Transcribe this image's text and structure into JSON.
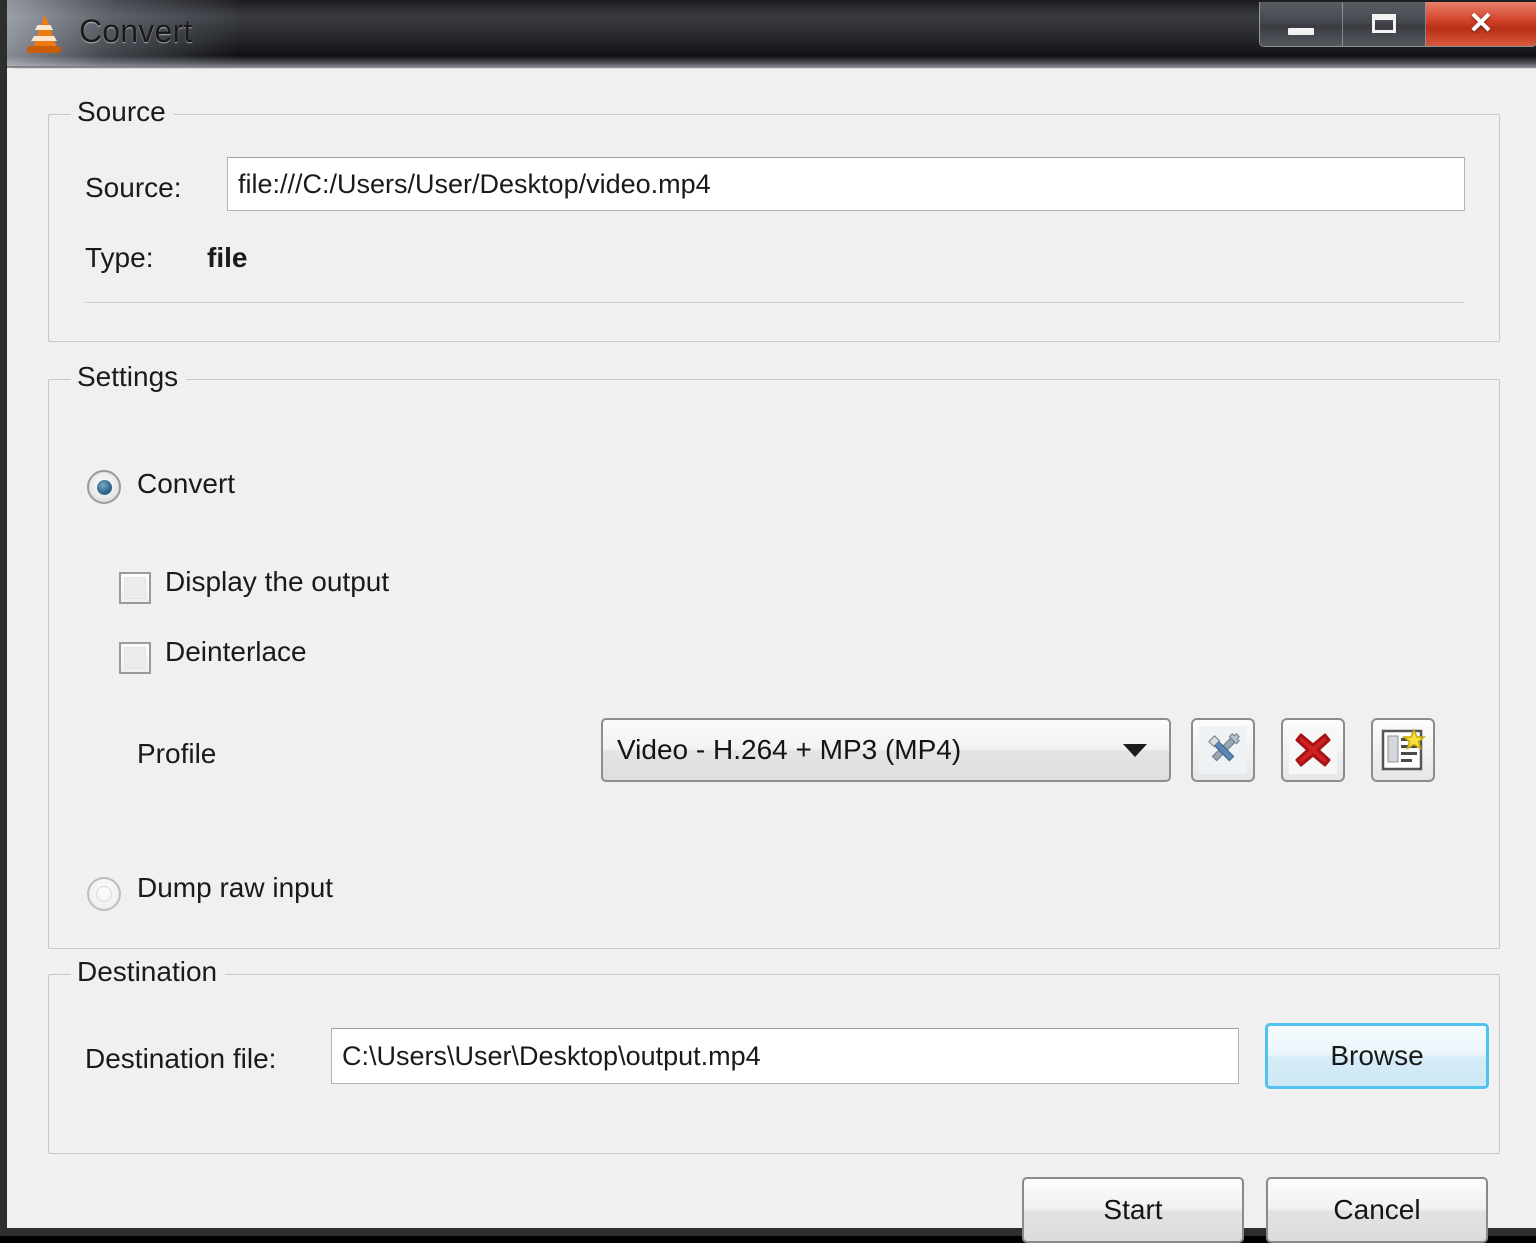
{
  "window": {
    "title": "Convert",
    "app_icon": "vlc-cone-icon",
    "controls": {
      "minimize": "minimize-icon",
      "maximize": "maximize-icon",
      "close": "✕"
    }
  },
  "source": {
    "legend": "Source",
    "source_label": "Source:",
    "source_value": "file:///C:/Users/User/Desktop/video.mp4",
    "type_label": "Type:",
    "type_value": "file"
  },
  "settings": {
    "legend": "Settings",
    "convert_label": "Convert",
    "display_output_label": "Display the output",
    "deinterlace_label": "Deinterlace",
    "profile_label": "Profile",
    "profile_value": "Video - H.264 + MP3 (MP4)",
    "dump_raw_label": "Dump raw input",
    "buttons": {
      "edit_profile": "edit-profile-icon",
      "delete_profile": "delete-profile-icon",
      "new_profile": "new-profile-icon"
    },
    "states": {
      "convert_selected": true,
      "dump_raw_selected": false,
      "display_output_checked": false,
      "deinterlace_checked": false
    }
  },
  "destination": {
    "legend": "Destination",
    "dest_label": "Destination file:",
    "dest_value": "C:\\Users\\User\\Desktop\\output.mp4",
    "browse_label": "Browse"
  },
  "footer": {
    "start_label": "Start",
    "cancel_label": "Cancel"
  },
  "colors": {
    "accent_focus": "#4fc2ef",
    "close_button": "#c9371f",
    "radio_selected": "#2f6b8f",
    "delete_icon": "#cc2222",
    "cone_orange": "#f07a12"
  }
}
